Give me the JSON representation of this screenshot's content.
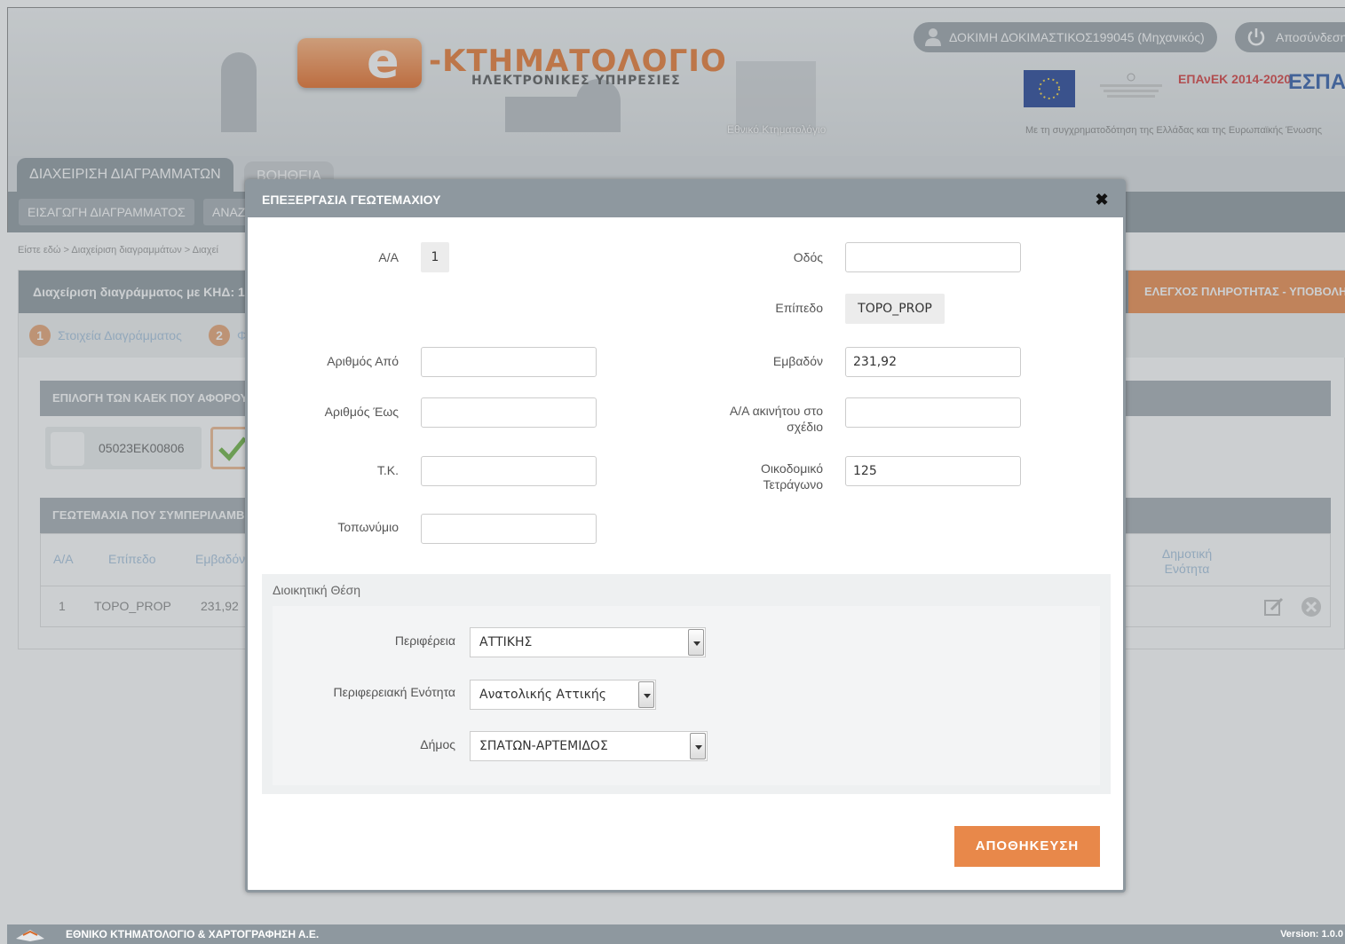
{
  "header": {
    "brand_title": "-ΚΤΗΜΑΤΟΛΟΓΙΟ",
    "brand_subtitle": "ΗΛΕΚΤΡΟΝΙΚΕΣ ΥΠΗΡΕΣΙΕΣ",
    "agency_name": "Εθνικό Κτηματολόγιο",
    "user_label": "ΔΟΚΙΜΗ ΔΟΚΙΜΑΣΤΙΚΟΣ199045 (Μηχανικός)",
    "logout_label": "Αποσύνδεση",
    "epanek_label": "ΕΠΑνΕΚ 2014-2020",
    "espa_label": "ΕΣΠΑ",
    "cofund_text": "Με τη συγχρηματοδότηση της Ελλάδας και της Ευρωπαϊκής Ένωσης"
  },
  "nav": {
    "tabs": [
      {
        "label": "ΔΙΑΧΕΙΡΙΣΗ ΔΙΑΓΡΑΜΜΑΤΩΝ"
      },
      {
        "label": "ΒΟΗΘΕΙΑ"
      }
    ],
    "subtabs": [
      {
        "label": "ΕΙΣΑΓΩΓΗ ΔΙΑΓΡΑΜΜΑΤΟΣ"
      },
      {
        "label": "ΑΝΑΖ"
      }
    ]
  },
  "page": {
    "breadcrumb": "Είστε εδώ > Διαχείριση διαγραμμάτων > Διαχεί",
    "panel_title": "Διαχείριση διαγράμματος με ΚΗΔ: 1",
    "panel_action": "ΕΛΕΓΧΟΣ ΠΛΗΡΟΤΗΤΑΣ - ΥΠΟΒΟΛΗ",
    "steps": [
      {
        "num": "1",
        "label": "Στοιχεία Διαγράμματος"
      },
      {
        "num": "2",
        "label": "Φ"
      }
    ],
    "kaek_section_title": "ΕΠΙΛΟΓΗ ΤΩΝ ΚΑΕΚ ΠΟΥ ΑΦΟΡΟΥ",
    "kaek_code": "05023ΕΚ00806",
    "parcels_section_title": "ΓΕΩΤΕΜΑΧΙΑ ΠΟΥ ΣΥΜΠΕΡΙΛΑΜΒ",
    "table_headers": [
      "Α/Α",
      "Επίπεδο",
      "Εμβαδόν",
      "Δημοτική Ενότητα"
    ],
    "table_row": [
      "1",
      "TOPO_PROP",
      "231,92"
    ]
  },
  "modal": {
    "title": "ΕΠΕΞΕΡΓΑΣΙΑ ΓΕΩΤΕΜΑΧΙΟΥ",
    "close_symbol": "✖",
    "aa_label": "Α/Α",
    "aa_value": "1",
    "odos_label": "Οδός",
    "odos_value": "",
    "epipedo_label": "Επίπεδο",
    "epipedo_value": "TOPO_PROP",
    "arithmos_apo_label": "Αριθμός Από",
    "arithmos_apo_value": "",
    "emvadon_label": "Εμβαδόν",
    "emvadon_value": "231,92",
    "arithmos_eos_label": "Αριθμός Έως",
    "arithmos_eos_value": "",
    "aa_akinitou_label": "Α/Α ακινήτου στο σχέδιο",
    "aa_akinitou_value": "",
    "tk_label": "Τ.Κ.",
    "tk_value": "",
    "oikodomiko_label": "Οικοδομικό Τετράγωνο",
    "oikodomiko_value": "125",
    "toponymio_label": "Τοπωνύμιο",
    "toponymio_value": "",
    "admin_title": "Διοικητική Θέση",
    "perifereia_label": "Περιφέρεια",
    "perifereia_value": "ΑΤΤΙΚΗΣ",
    "perif_enotita_label": "Περιφερειακή Ενότητα",
    "perif_enotita_value": "Ανατολικής Αττικής",
    "dimos_label": "Δήμος",
    "dimos_value": "ΣΠΑΤΩΝ-ΑΡΤΕΜΙΔΟΣ",
    "save_label": "ΑΠΟΘΗΚΕΥΣΗ"
  },
  "footer": {
    "company": "ΕΘΝΙΚΟ ΚΤΗΜΑΤΟΛΟΓΙΟ & ΧΑΡΤΟΓΡΑΦΗΣΗ Α.Ε.",
    "version": "Version: 1.0.0"
  },
  "colors": {
    "accent_orange": "#e8884a",
    "header_gray": "#8e989f",
    "link_blue": "#a7c3de"
  }
}
